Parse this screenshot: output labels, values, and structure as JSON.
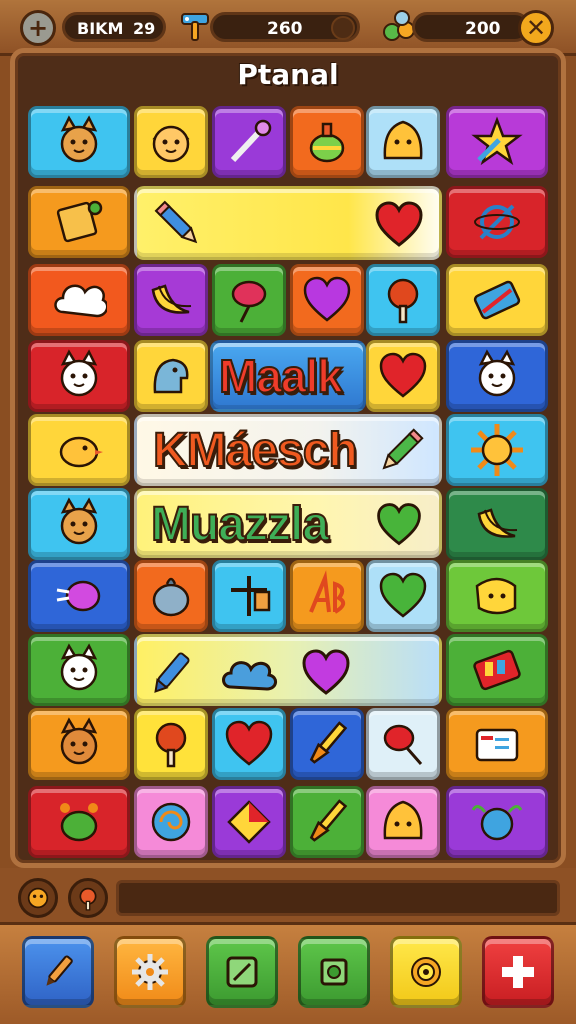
{
  "header": {
    "player_label": "BIKM",
    "player_value": "29",
    "coins": "260",
    "gems": "200"
  },
  "board": {
    "title": "Ptanal",
    "words": [
      "Maalk",
      "KMáesch",
      "Muazzla"
    ]
  },
  "tiles": [
    "cat-face",
    "boy-face",
    "magic-wand",
    "green-potion",
    "yellow-blob",
    "star-arrow",
    "spellbook",
    "pencil",
    "heart",
    "crossed-planet",
    "cloud",
    "banana",
    "lollipop",
    "purple-heart",
    "ice-pop",
    "chest",
    "cat-face",
    "elephant",
    "heart",
    "cat-face",
    "chick",
    "pencil",
    "sun",
    "cat-face",
    "heart",
    "banana",
    "jelly-splash",
    "turnip",
    "cross-glyph",
    "glyph",
    "green-heart",
    "dog-face",
    "cat-face",
    "popsicle",
    "cloud",
    "purple-heart",
    "paint-box",
    "cat-face",
    "ice-pop",
    "red-heart",
    "paintbrush",
    "meat",
    "medical-kit",
    "green-bug",
    "swirl-candy",
    "kite",
    "paintbrush",
    "blob-face",
    "blue-bug"
  ],
  "colors": {
    "wood": "#8a4e22",
    "board": "#4f2d18",
    "frame": "#b0723f"
  },
  "actions": [
    "pencil-icon",
    "gear-icon",
    "image-icon",
    "settings-icon",
    "target-icon",
    "plus-icon"
  ]
}
